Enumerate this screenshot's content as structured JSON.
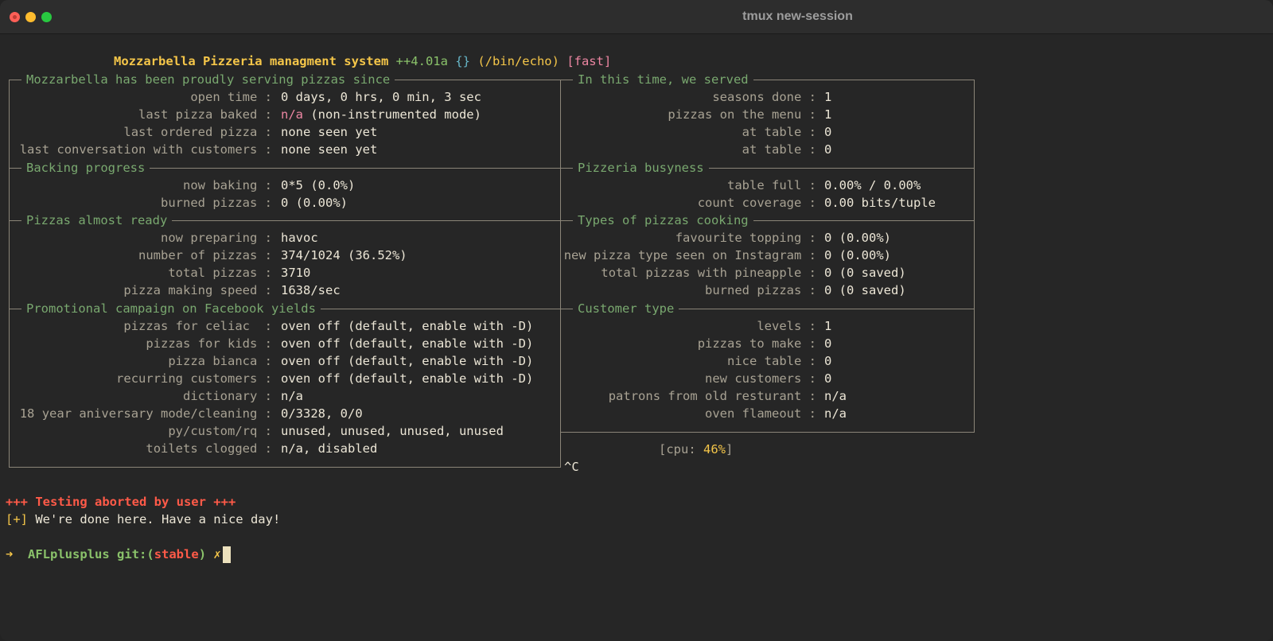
{
  "window": {
    "title": "tmux new-session"
  },
  "banner": {
    "name": "Mozzarbella Pizzeria managment system",
    "version": "++4.01a",
    "braces": "{}",
    "target": "(/bin/echo)",
    "mode": "[fast]"
  },
  "sections": {
    "since": "Mozzarbella has been proudly serving pizzas since",
    "served": "In this time, we served",
    "backing": "Backing progress",
    "busyness": "Pizzeria busyness",
    "almost": "Pizzas almost ready",
    "types": "Types of pizzas cooking",
    "promo": "Promotional campaign on Facebook yields",
    "customer": "Customer type"
  },
  "left": {
    "since_rows": [
      {
        "label": "open time :",
        "value": "0 days, 0 hrs, 0 min, 3 sec"
      },
      {
        "label": "last pizza baked :",
        "value_hl": "n/a",
        "value": " (non-instrumented mode)"
      },
      {
        "label": "last ordered pizza :",
        "value": "none seen yet"
      },
      {
        "label": "last conversation with customers :",
        "value": "none seen yet"
      }
    ],
    "backing_rows": [
      {
        "label": "now baking :",
        "value": "0*5 (0.0%)"
      },
      {
        "label": "burned pizzas :",
        "value": "0 (0.00%)"
      }
    ],
    "almost_rows": [
      {
        "label": "now preparing :",
        "value": "havoc"
      },
      {
        "label": "number of pizzas :",
        "value": "374/1024 (36.52%)"
      },
      {
        "label": "total pizzas :",
        "value": "3710"
      },
      {
        "label": "pizza making speed :",
        "value": "1638/sec"
      }
    ],
    "promo_rows": [
      {
        "label": "pizzas for celiac  :",
        "value": "oven off (default, enable with -D)"
      },
      {
        "label": "pizzas for kids :",
        "value": "oven off (default, enable with -D)"
      },
      {
        "label": "pizza bianca :",
        "value": "oven off (default, enable with -D)"
      },
      {
        "label": "recurring customers :",
        "value": "oven off (default, enable with -D)"
      },
      {
        "label": "dictionary :",
        "value": "n/a"
      },
      {
        "label": "18 year aniversary mode/cleaning :",
        "value": "0/3328, 0/0"
      },
      {
        "label": "py/custom/rq :",
        "value": "unused, unused, unused, unused"
      },
      {
        "label": "toilets clogged :",
        "value": "n/a, disabled"
      }
    ]
  },
  "right": {
    "served_rows": [
      {
        "label": "seasons done :",
        "value": "1"
      },
      {
        "label": "pizzas on the menu :",
        "value": "1"
      },
      {
        "label": "at table :",
        "value": "0"
      },
      {
        "label": "at table :",
        "value": "0"
      }
    ],
    "busyness_rows": [
      {
        "label": "table full :",
        "value": "0.00% / 0.00%"
      },
      {
        "label": "count coverage :",
        "value": "0.00 bits/tuple"
      }
    ],
    "types_rows": [
      {
        "label": "favourite topping :",
        "value": "0 (0.00%)"
      },
      {
        "label": "new pizza type seen on Instagram :",
        "value": "0 (0.00%)"
      },
      {
        "label": "total pizzas with pineapple :",
        "value": "0 (0 saved)"
      },
      {
        "label": "burned pizzas :",
        "value": "0 (0 saved)"
      }
    ],
    "customer_rows": [
      {
        "label": "levels :",
        "value": "1"
      },
      {
        "label": "pizzas to make :",
        "value": "0"
      },
      {
        "label": "nice table :",
        "value": "0"
      },
      {
        "label": "new customers :",
        "value": "0"
      },
      {
        "label": "patrons from old resturant :",
        "value": "n/a"
      },
      {
        "label": "oven flameout :",
        "value": "n/a"
      }
    ]
  },
  "cpu": {
    "open": "[cpu: ",
    "value": "46%",
    "close": "]"
  },
  "interrupt": "^C",
  "aborted": "+++ Testing aborted by user +++",
  "done": {
    "tag": "[+]",
    "text": " We're done here. Have a nice day!"
  },
  "prompt": {
    "arrow": "➜",
    "dir": "AFLplusplus",
    "git_open": "git:(",
    "branch": "stable",
    "git_close": ")",
    "dirty": "✗"
  }
}
